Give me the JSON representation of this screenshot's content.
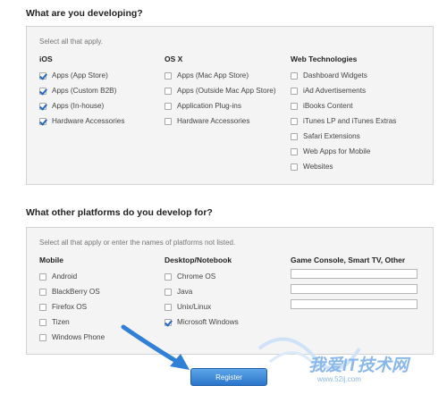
{
  "section1": {
    "title": "What are you developing?",
    "hint": "Select all that apply.",
    "columns": [
      {
        "heading": "iOS",
        "options": [
          {
            "label": "Apps (App Store)",
            "checked": true
          },
          {
            "label": "Apps (Custom B2B)",
            "checked": true
          },
          {
            "label": "Apps (In-house)",
            "checked": true
          },
          {
            "label": "Hardware Accessories",
            "checked": true
          }
        ]
      },
      {
        "heading": "OS X",
        "options": [
          {
            "label": "Apps (Mac App Store)",
            "checked": false
          },
          {
            "label": "Apps (Outside Mac App Store)",
            "checked": false
          },
          {
            "label": "Application Plug-ins",
            "checked": false
          },
          {
            "label": "Hardware Accessories",
            "checked": false
          }
        ]
      },
      {
        "heading": "Web Technologies",
        "options": [
          {
            "label": "Dashboard Widgets",
            "checked": false
          },
          {
            "label": "iAd Advertisements",
            "checked": false
          },
          {
            "label": "iBooks Content",
            "checked": false
          },
          {
            "label": "iTunes LP and iTunes Extras",
            "checked": false
          },
          {
            "label": "Safari Extensions",
            "checked": false
          },
          {
            "label": "Web Apps for Mobile",
            "checked": false
          },
          {
            "label": "Websites",
            "checked": false
          }
        ]
      }
    ]
  },
  "section2": {
    "title": "What other platforms do you develop for?",
    "hint": "Select all that apply or enter the names of platforms not listed.",
    "columns": [
      {
        "heading": "Mobile",
        "options": [
          {
            "label": "Android",
            "checked": false
          },
          {
            "label": "BlackBerry OS",
            "checked": false
          },
          {
            "label": "Firefox OS",
            "checked": false
          },
          {
            "label": "Tizen",
            "checked": false
          },
          {
            "label": "Windows Phone",
            "checked": false
          }
        ]
      },
      {
        "heading": "Desktop/Notebook",
        "options": [
          {
            "label": "Chrome OS",
            "checked": false
          },
          {
            "label": "Java",
            "checked": false
          },
          {
            "label": "Unix/Linux",
            "checked": false
          },
          {
            "label": "Microsoft Windows",
            "checked": true
          }
        ]
      },
      {
        "heading": "Game Console, Smart TV, Other",
        "fields": [
          "",
          "",
          ""
        ]
      }
    ]
  },
  "register_label": "Register",
  "watermark": {
    "text": "我爱IT技术网",
    "url": "www.52ij.com"
  },
  "colors": {
    "accent": "#2a75c9",
    "annotation_arrow": "#2f80d6"
  }
}
